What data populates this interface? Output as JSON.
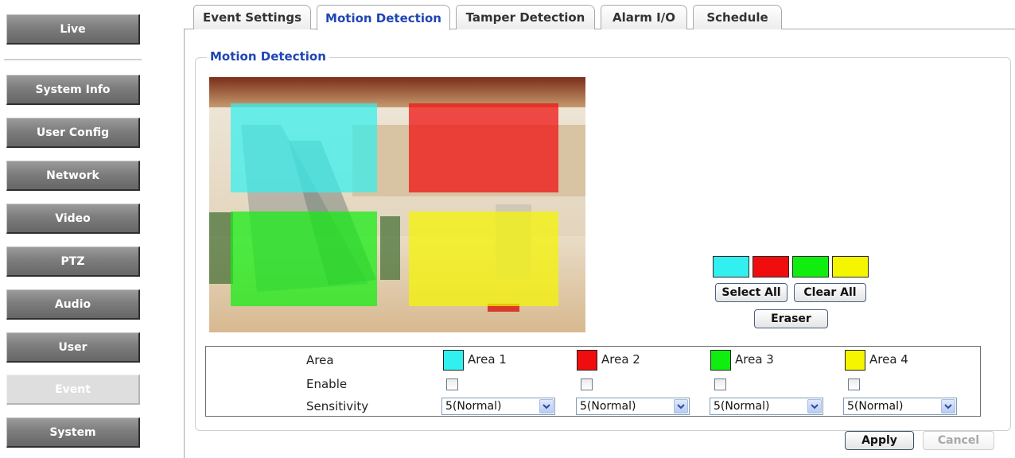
{
  "nav": {
    "live": "Live",
    "items": [
      "System Info",
      "User Config",
      "Network",
      "Video",
      "PTZ",
      "Audio",
      "User",
      "Event",
      "System"
    ],
    "active": "Event"
  },
  "tabs": [
    {
      "label": "Event Settings"
    },
    {
      "label": "Motion Detection",
      "active": true
    },
    {
      "label": "Tamper Detection"
    },
    {
      "label": "Alarm I/O"
    },
    {
      "label": "Schedule"
    }
  ],
  "section_title": "Motion Detection",
  "colors": {
    "area1": "#33f0f0",
    "area2": "#f00d0d",
    "area3": "#10ee10",
    "area4": "#f5f500",
    "active_tab": "#2046b4"
  },
  "buttons": {
    "select_all": "Select All",
    "clear_all": "Clear All",
    "eraser": "Eraser",
    "apply": "Apply",
    "cancel": "Cancel"
  },
  "settings": {
    "area_label": "Area",
    "enable_label": "Enable",
    "sensitivity_label": "Sensitivity",
    "areas": [
      {
        "name": "Area 1",
        "color": "#33f0f0",
        "enabled": false,
        "sensitivity": "5(Normal)"
      },
      {
        "name": "Area 2",
        "color": "#f00d0d",
        "enabled": false,
        "sensitivity": "5(Normal)"
      },
      {
        "name": "Area 3",
        "color": "#10ee10",
        "enabled": false,
        "sensitivity": "5(Normal)"
      },
      {
        "name": "Area 4",
        "color": "#f5f500",
        "enabled": false,
        "sensitivity": "5(Normal)"
      }
    ]
  }
}
